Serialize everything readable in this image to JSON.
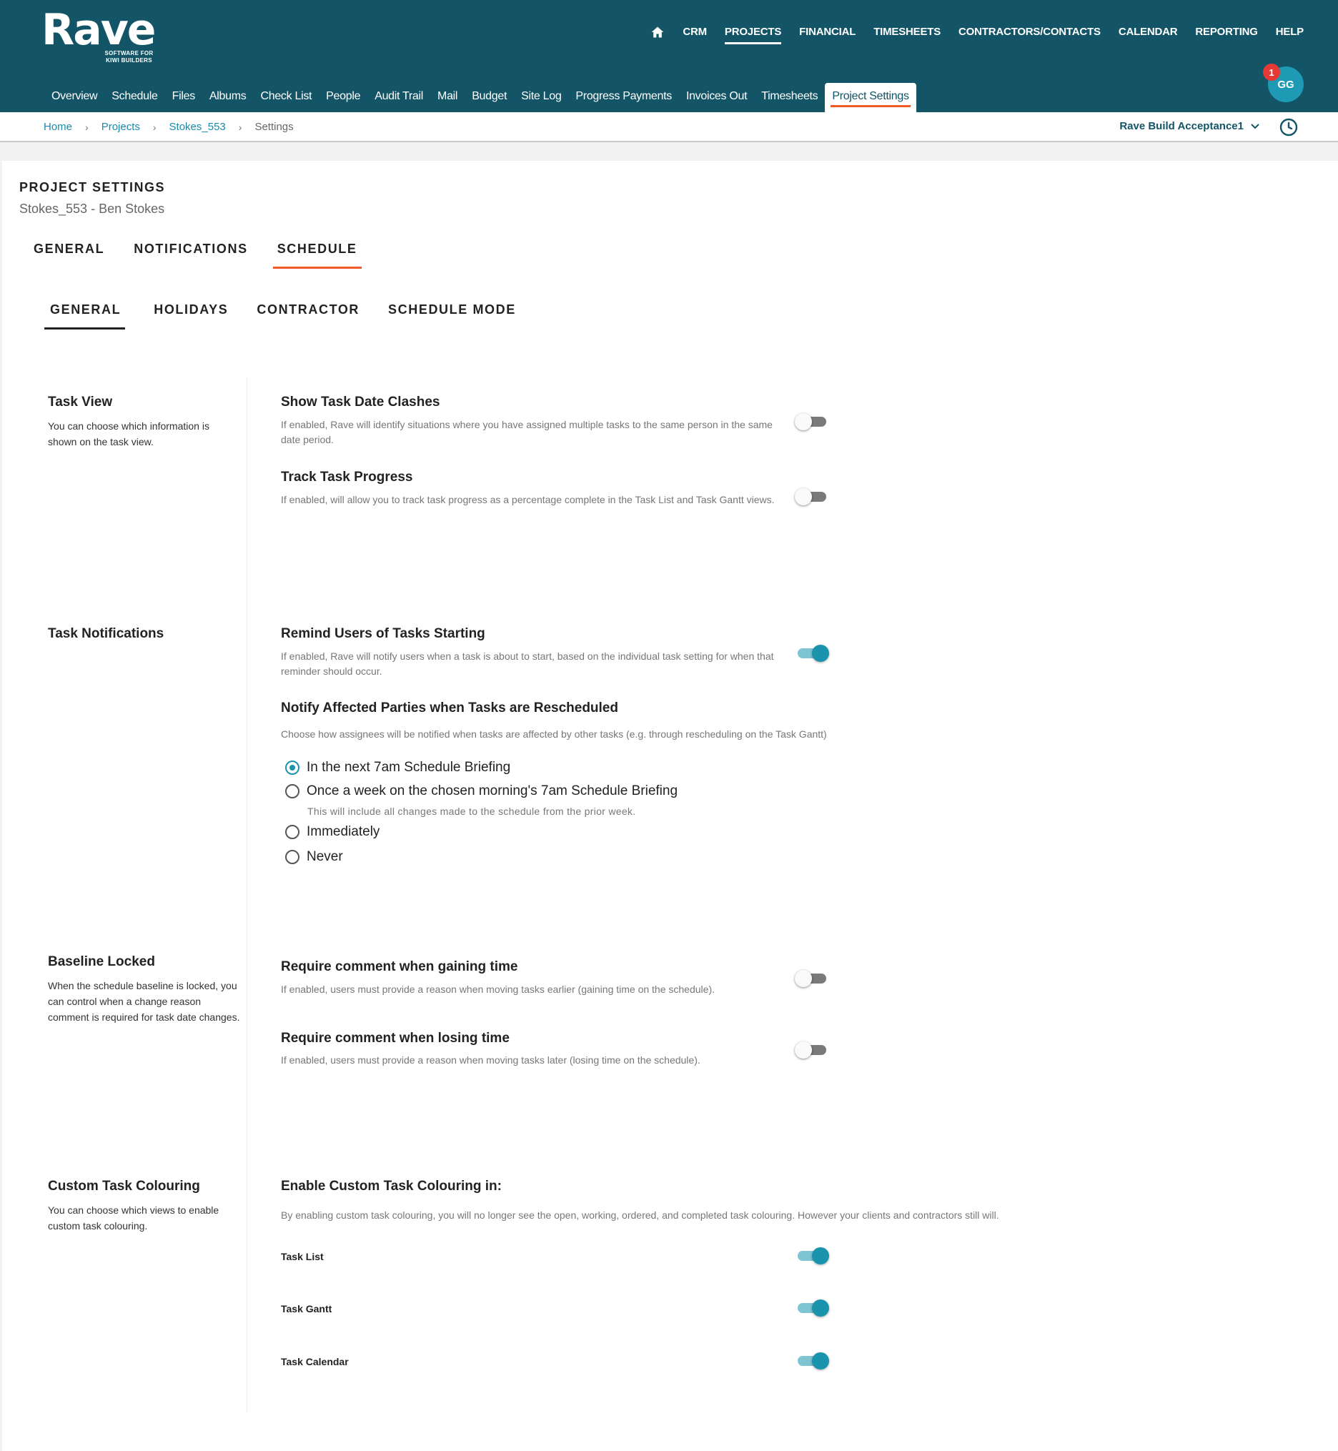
{
  "brand": {
    "name": "Rave",
    "tagline_line1": "SOFTWARE FOR",
    "tagline_line2": "KIWI BUILDERS"
  },
  "top_nav": [
    "CRM",
    "PROJECTS",
    "FINANCIAL",
    "TIMESHEETS",
    "CONTRACTORS/CONTACTS",
    "CALENDAR",
    "REPORTING",
    "HELP"
  ],
  "sub_nav": [
    "Overview",
    "Schedule",
    "Files",
    "Albums",
    "Check List",
    "People",
    "Audit Trail",
    "Mail",
    "Budget",
    "Site Log",
    "Progress Payments",
    "Invoices Out",
    "Timesheets",
    "Project Settings"
  ],
  "user": {
    "initials": "GG",
    "notification_count": "1"
  },
  "breadcrumb": [
    "Home",
    "Projects",
    "Stokes_553",
    "Settings"
  ],
  "account": "Rave Build Acceptance1",
  "page": {
    "title": "PROJECT SETTINGS",
    "subtitle": "Stokes_553 - Ben Stokes"
  },
  "tabs": [
    "GENERAL",
    "NOTIFICATIONS",
    "SCHEDULE"
  ],
  "subtabs": [
    "GENERAL",
    "HOLIDAYS",
    "CONTRACTOR",
    "SCHEDULE MODE"
  ],
  "sections": {
    "task_view": {
      "title": "Task View",
      "desc": "You can choose which information is shown on the task view.",
      "date_clashes": {
        "title": "Show Task Date Clashes",
        "desc": "If enabled, Rave will identify situations where you have assigned multiple tasks to the same person in the same date period.",
        "enabled": false
      },
      "track_progress": {
        "title": "Track Task Progress",
        "desc": "If enabled, will allow you to track task progress as a percentage complete in the Task List and Task Gantt views.",
        "enabled": false
      }
    },
    "task_notifications": {
      "title": "Task Notifications",
      "remind": {
        "title": "Remind Users of Tasks Starting",
        "desc": "If enabled, Rave will notify users when a task is about to start, based on the individual task setting for when that reminder should occur.",
        "enabled": true
      },
      "notify": {
        "title": "Notify Affected Parties when Tasks are Rescheduled",
        "desc": "Choose how assignees will be notified when tasks are affected by other tasks (e.g. through rescheduling on the Task Gantt)",
        "options": [
          "In the next 7am Schedule Briefing",
          "Once a week on the chosen morning's 7am Schedule Briefing",
          "Immediately",
          "Never"
        ],
        "weekly_note": "This will include all changes made to the schedule from the prior week.",
        "selected": "In the next 7am Schedule Briefing"
      }
    },
    "baseline_locked": {
      "title": "Baseline Locked",
      "desc": "When the schedule baseline is locked, you can control when a change reason comment is required for task date changes.",
      "gaining": {
        "title": "Require comment when gaining time",
        "desc": "If enabled, users must provide a reason when moving tasks earlier (gaining time on the schedule).",
        "enabled": false
      },
      "losing": {
        "title": "Require comment when losing time",
        "desc": "If enabled, users must provide a reason when moving tasks later (losing time on the schedule).",
        "enabled": false
      }
    },
    "custom_colouring": {
      "title": "Custom Task Colouring",
      "desc": "You can choose which views to enable custom task colouring.",
      "enable_title": "Enable Custom Task Colouring in:",
      "enable_desc": "By enabling custom task colouring, you will no longer see the open, working, ordered, and completed task colouring. However your clients and contractors still will.",
      "views": [
        {
          "label": "Task List",
          "enabled": true
        },
        {
          "label": "Task Gantt",
          "enabled": true
        },
        {
          "label": "Task Calendar",
          "enabled": true
        }
      ]
    }
  },
  "colors": {
    "header": "#135567",
    "accent": "#f05a28",
    "toggle_on": "#1a93ad",
    "link": "#1a8aa8"
  }
}
